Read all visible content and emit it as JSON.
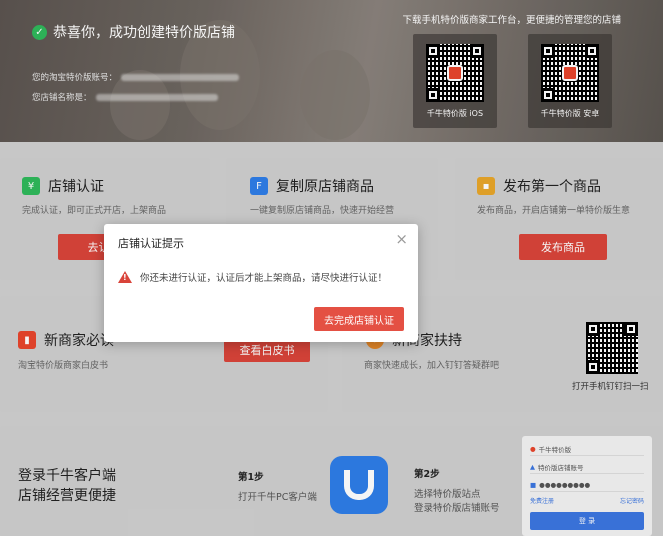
{
  "banner": {
    "title": "恭喜你，成功创建特价版店铺",
    "account_label": "您的淘宝特价版账号：",
    "store_label": "您店铺名称是：",
    "download_title": "下载手机特价版商家工作台，更便捷的管理您的店铺",
    "qr_ios_label": "千牛特价版 iOS",
    "qr_android_label": "千牛特价版 安卓",
    "qr_logo_text": "特价"
  },
  "cards": {
    "auth": {
      "title": "店铺认证",
      "desc": "完成认证，即可正式开店，上架商品",
      "button": "去认证"
    },
    "copy": {
      "title": "复制原店铺商品",
      "desc": "一键复制原店铺商品，快速开始经营"
    },
    "publish": {
      "title": "发布第一个商品",
      "desc": "发布商品，开启店铺第一单特价版生意",
      "button": "发布商品"
    },
    "newbie": {
      "title": "新商家必读",
      "desc": "淘宝特价版商家白皮书",
      "button": "查看白皮书"
    },
    "support": {
      "title": "新商家扶持",
      "desc": "商家快速成长，加入钉钉答疑群吧",
      "qr_caption": "打开手机钉钉扫一扫"
    }
  },
  "bottom": {
    "headline_1": "登录千牛客户端",
    "headline_2": "店铺经营更便捷",
    "step1_title": "第1步",
    "step1_desc": "打开千牛PC客户端",
    "step2_title": "第2步",
    "step2_desc_1": "选择特价版站点",
    "step2_desc_2": "登录特价版店铺账号",
    "login_panel": {
      "site": "千牛特价版",
      "account": "特价版店铺账号",
      "password": "●●●●●●●●●",
      "link_left": "免费注册",
      "link_right": "忘记密码",
      "login": "登 录"
    }
  },
  "modal": {
    "title": "店铺认证提示",
    "message": "你还未进行认证，认证后才能上架商品，请尽快进行认证！",
    "button": "去完成店铺认证"
  },
  "colors": {
    "accent_red": "#d9443a",
    "success_green": "#2fb95b",
    "brand_blue": "#2e7de8"
  }
}
